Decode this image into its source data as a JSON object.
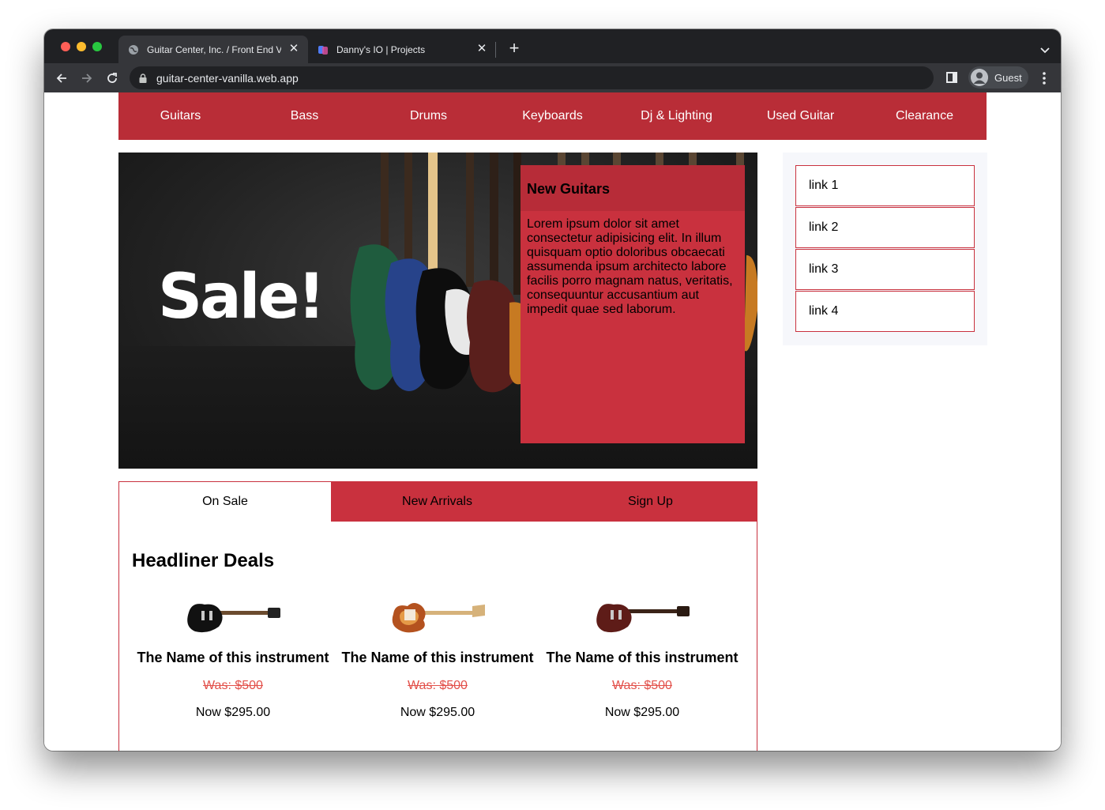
{
  "browser": {
    "tabs": [
      {
        "title": "Guitar Center, Inc. / Front End V",
        "active": true,
        "favicon": "globe-icon"
      },
      {
        "title": "Danny's IO | Projects",
        "active": false,
        "favicon": "site-logo-icon"
      }
    ],
    "url": "guitar-center-vanilla.web.app",
    "profile_label": "Guest"
  },
  "nav": {
    "items": [
      "Guitars",
      "Bass",
      "Drums",
      "Keyboards",
      "Dj & Lighting",
      "Used Guitar",
      "Clearance"
    ]
  },
  "hero": {
    "sale_text": "Sale!",
    "promo_title": "New Guitars",
    "promo_text": "Lorem ipsum dolor sit amet consectetur adipisicing elit. In illum quisquam optio doloribus obcaecati assumenda ipsum architecto labore facilis porro magnam natus, veritatis, consequuntur accusantium aut impedit quae sed laborum."
  },
  "sidebar": {
    "links": [
      "link 1",
      "link 2",
      "link 3",
      "link 4"
    ]
  },
  "tabs": {
    "items": [
      "On Sale",
      "New Arrivals",
      "Sign Up"
    ],
    "active": "On Sale"
  },
  "deals": {
    "title": "Headliner Deals",
    "products": [
      {
        "name": "The Name of this instrument",
        "was": "Was: $500",
        "now": "Now $295.00",
        "image": "black-les-paul-guitar"
      },
      {
        "name": "The Name of this instrument",
        "was": "Was: $500",
        "now": "Now $295.00",
        "image": "sunburst-stratocaster-guitar"
      },
      {
        "name": "The Name of this instrument",
        "was": "Was: $500",
        "now": "Now $295.00",
        "image": "wine-red-les-paul-guitar"
      }
    ]
  },
  "colors": {
    "brand_red": "#b92d37",
    "promo_red": "#c9313e",
    "was_price": "#e2504a",
    "sidebar_bg": "#f6f7fb"
  }
}
